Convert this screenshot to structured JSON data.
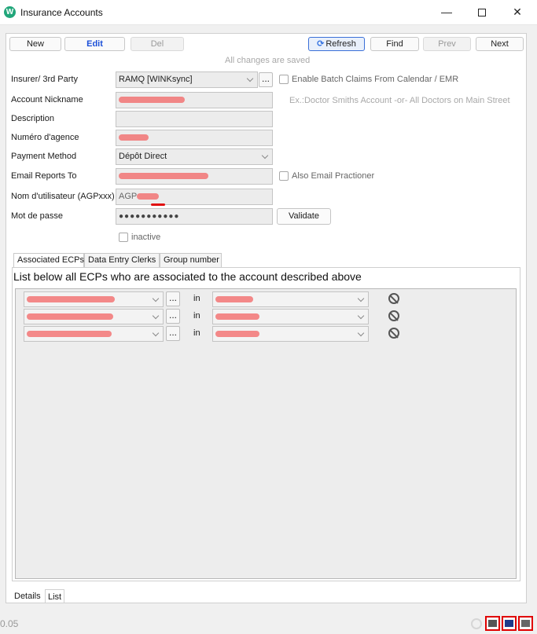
{
  "window": {
    "title": "Insurance Accounts",
    "controls": {
      "minimize": "—",
      "maximize": "",
      "close": "✕"
    }
  },
  "toolbar": {
    "new": "New",
    "edit": "Edit",
    "del": "Del",
    "refresh": "Refresh",
    "find": "Find",
    "prev": "Prev",
    "next": "Next",
    "status": "All changes are saved"
  },
  "form": {
    "insurer_label": "Insurer/ 3rd Party",
    "insurer_value": "RAMQ [WINKsync]",
    "batch_claims_label": "Enable Batch Claims From Calendar / EMR",
    "nickname_label": "Account Nickname",
    "nickname_hint": "Ex.:Doctor Smiths Account -or- All Doctors on Main Street",
    "description_label": "Description",
    "description_value": "",
    "agency_label": "Numéro d'agence",
    "payment_label": "Payment Method",
    "payment_value": "Dépôt Direct",
    "email_label": "Email Reports To",
    "also_email_label": "Also Email Practioner",
    "username_label": "Nom d'utilisateur (AGPxxx)",
    "username_prefix": "AGP",
    "password_label": "Mot de passe",
    "password_value": "●●●●●●●●●●●",
    "validate": "Validate",
    "inactive_label": "inactive"
  },
  "tabs": {
    "associated": "Associated ECPs",
    "clerks": "Data Entry Clerks",
    "group": "Group number"
  },
  "ecp": {
    "heading": "List below all ECPs who are associated to the account described above",
    "rows": [
      {
        "dots": "...",
        "in": "in"
      },
      {
        "dots": "...",
        "in": "in"
      },
      {
        "dots": "...",
        "in": "in"
      }
    ]
  },
  "bottom": {
    "details_tab": "Details",
    "list_tab": "List",
    "version": "0.05"
  },
  "colors": {
    "accent": "#21a67a",
    "edit": "#1b4fd8",
    "redaction": "#f27474",
    "status_frame": "#e00000"
  }
}
